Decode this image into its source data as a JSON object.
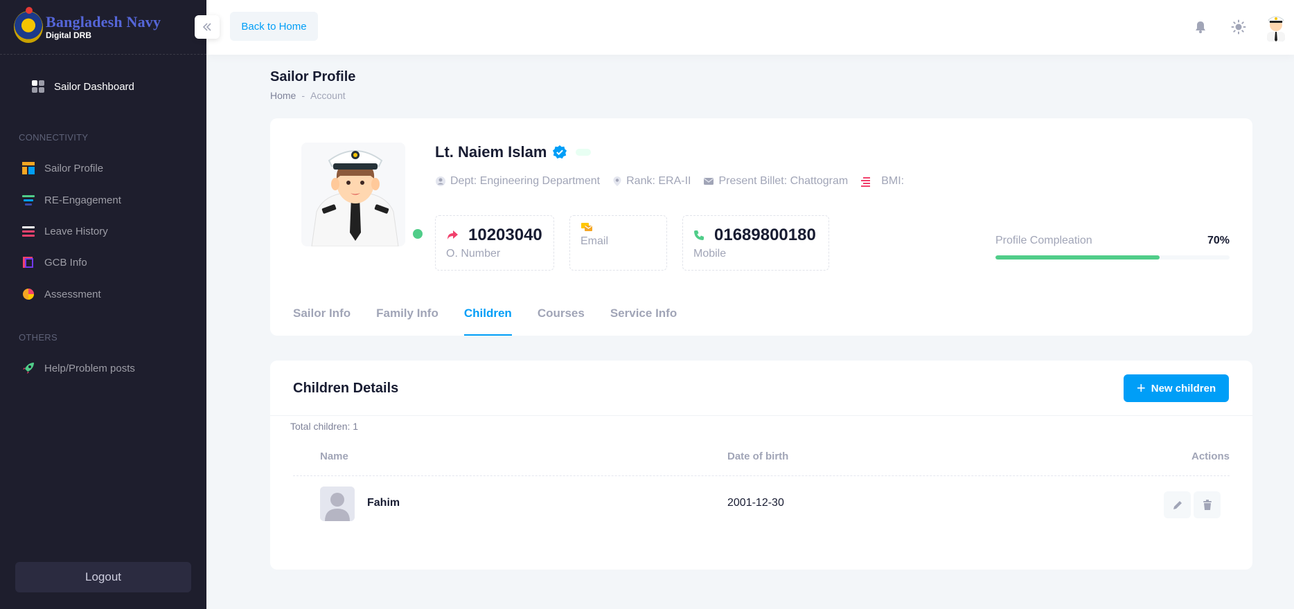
{
  "brand": {
    "title": "Bangladesh Navy",
    "subtitle": "Digital DRB"
  },
  "sidebar": {
    "dashboard_label": "Sailor Dashboard",
    "section_connectivity": "CONNECTIVITY",
    "items": [
      {
        "label": "Sailor Profile",
        "icon": "layout-icon"
      },
      {
        "label": "RE-Engagement",
        "icon": "layers-icon"
      },
      {
        "label": "Leave History",
        "icon": "list-icon"
      },
      {
        "label": "GCB Info",
        "icon": "book-icon"
      },
      {
        "label": "Assessment",
        "icon": "pie-chart-icon"
      }
    ],
    "section_others": "OTHERS",
    "help_label": "Help/Problem posts",
    "logout_label": "Logout"
  },
  "header": {
    "back_label": "Back to Home"
  },
  "page": {
    "title": "Sailor Profile",
    "breadcrumb": [
      "Home",
      "-",
      "Account"
    ]
  },
  "profile": {
    "name": "Lt. Naiem Islam",
    "dept": "Dept: Engineering Department",
    "rank": "Rank: ERA-II",
    "billet": "Present Billet: Chattogram",
    "bmi": "BMI:",
    "stats": {
      "o_number": {
        "value": "10203040",
        "label": "O. Number"
      },
      "email": {
        "value": "",
        "label": "Email"
      },
      "mobile": {
        "value": "01689800180",
        "label": "Mobile"
      }
    },
    "completion_label": "Profile Compleation",
    "completion_text": "70%",
    "completion_value": 70
  },
  "tabs": [
    "Sailor Info",
    "Family Info",
    "Children",
    "Courses",
    "Service Info"
  ],
  "active_tab": "Children",
  "children": {
    "title": "Children Details",
    "new_button": "New children",
    "total": "Total children: 1",
    "columns": {
      "name": "Name",
      "dob": "Date of birth",
      "actions": "Actions"
    },
    "rows": [
      {
        "name": "Fahim",
        "dob": "2001-12-30"
      }
    ]
  },
  "colors": {
    "primary": "#009ef7",
    "success": "#50cd89",
    "sidebar": "#1e1e2d"
  }
}
